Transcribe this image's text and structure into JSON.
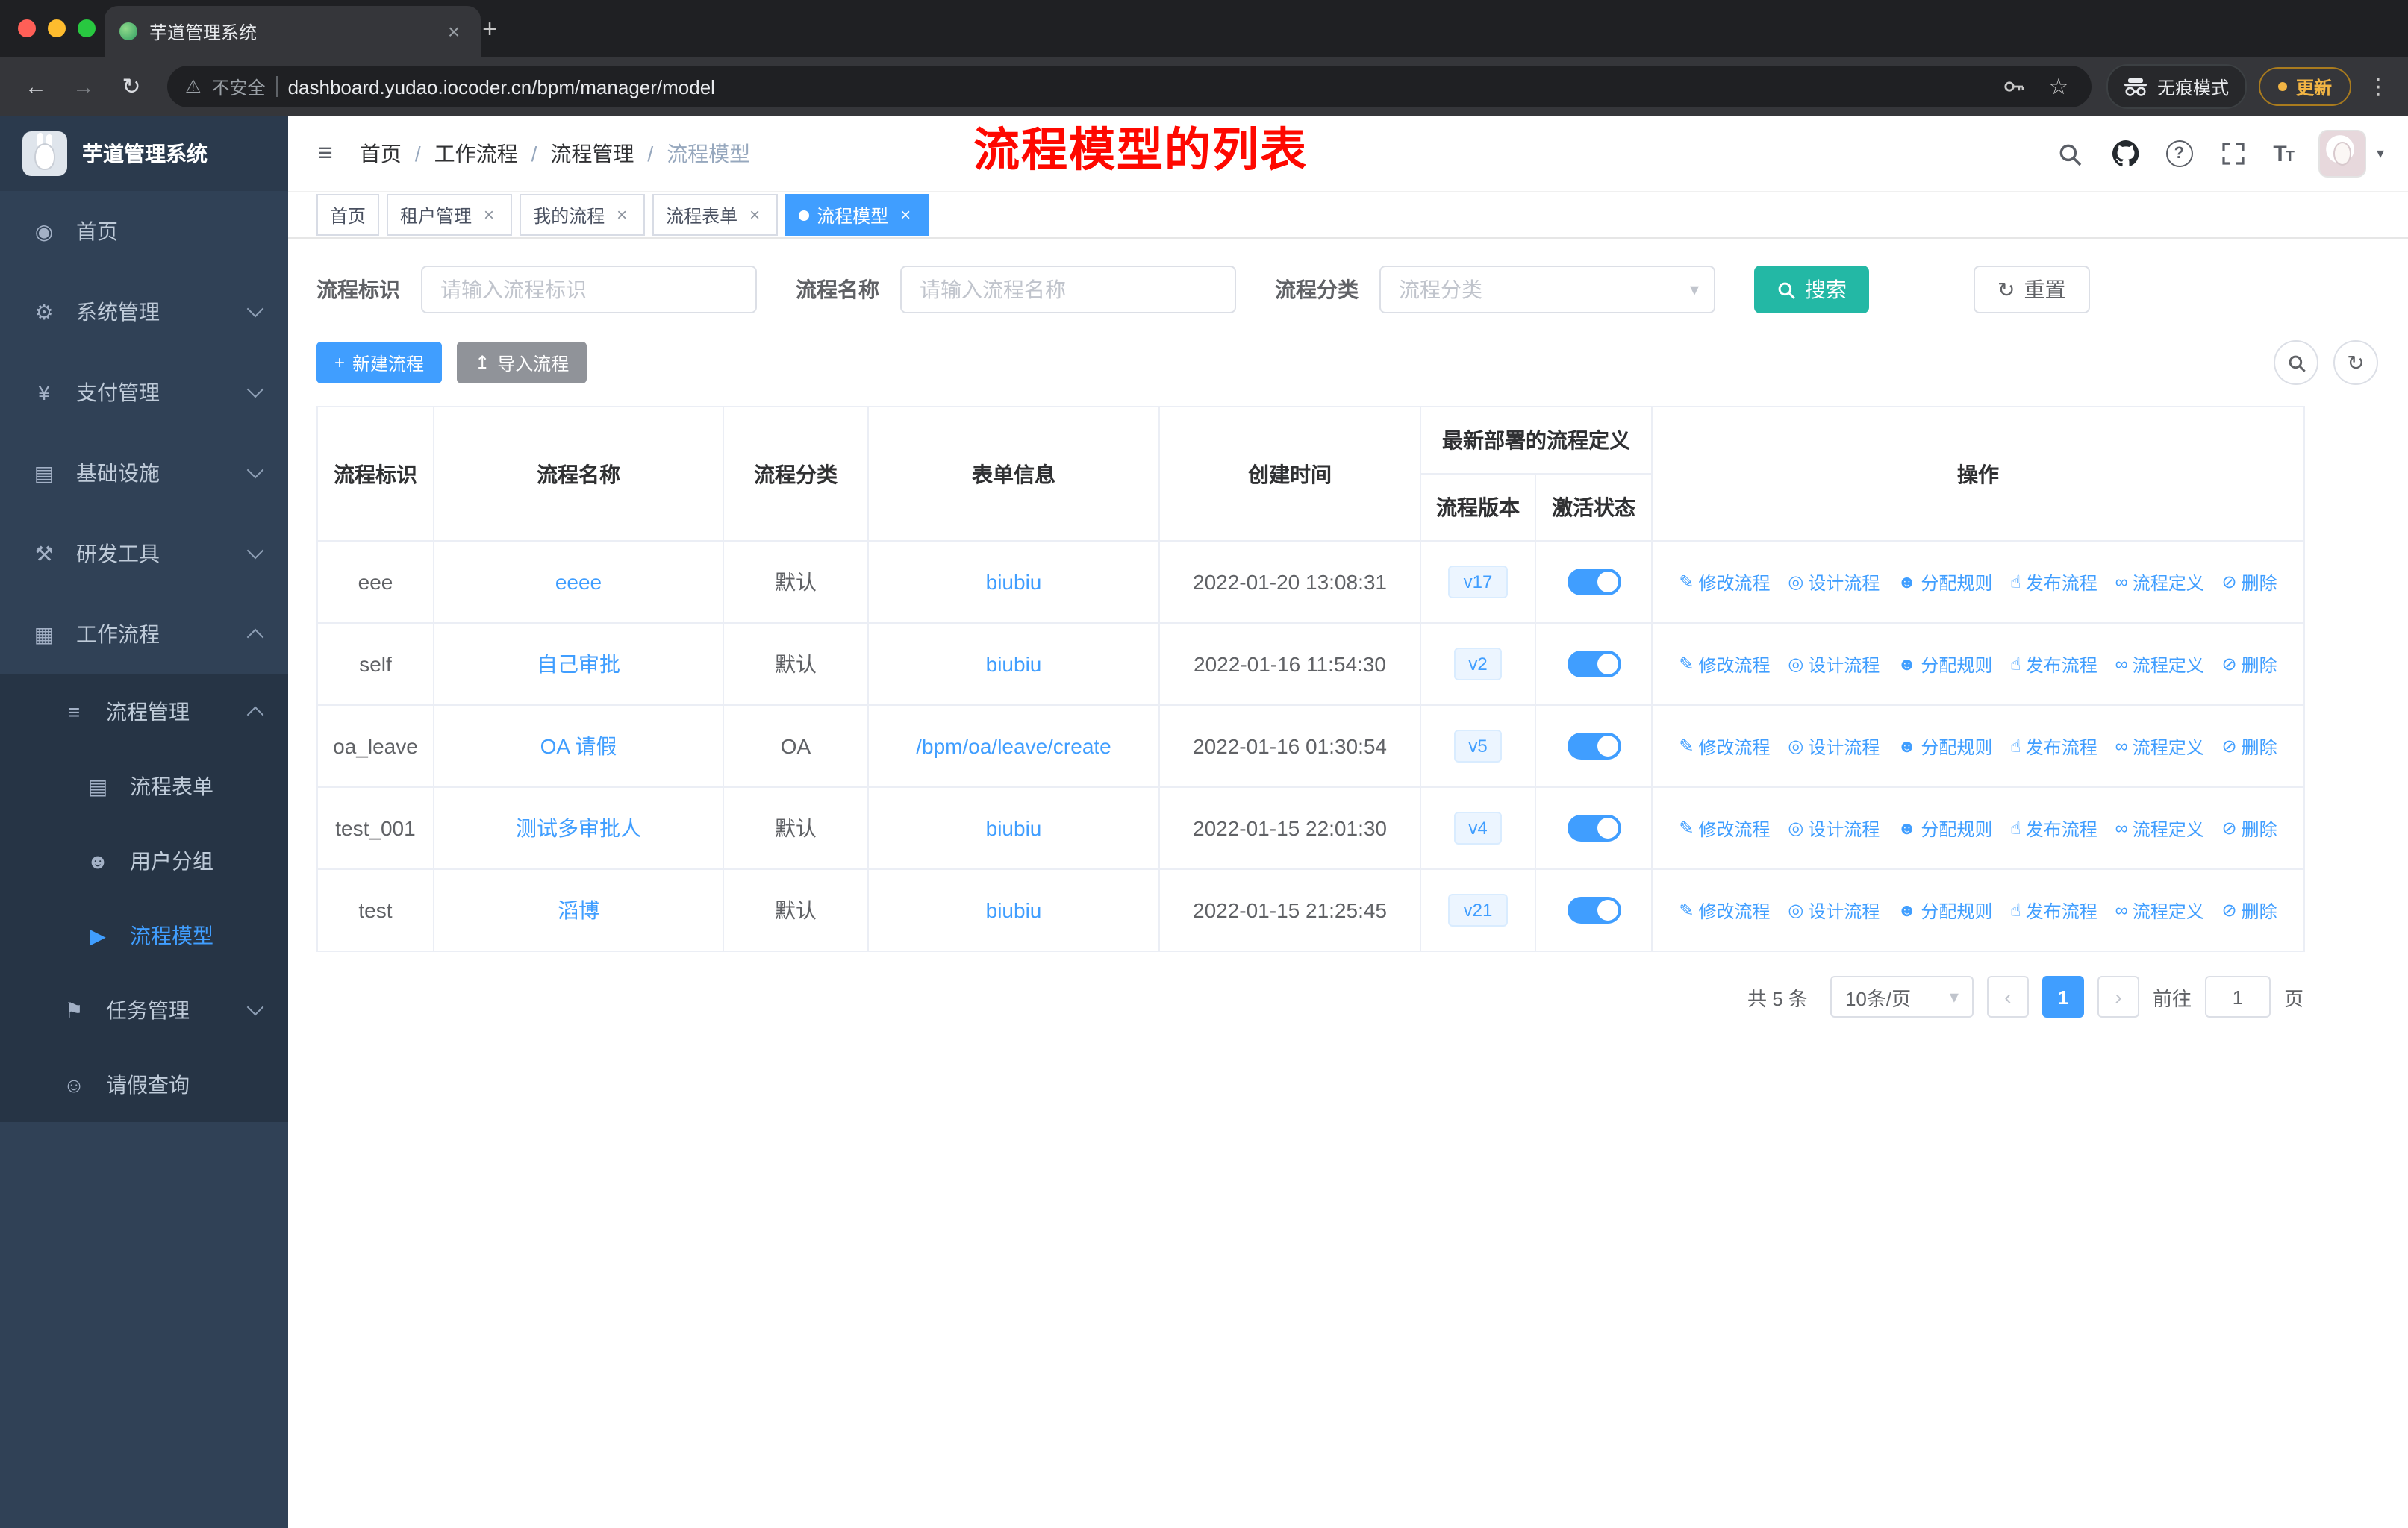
{
  "colors": {
    "primary": "#409EFF",
    "search_button_teal": "#23B8A5",
    "annotation_red": "#FE0800",
    "sidebar_bg": "#304156",
    "sidebar_active_text": "#409EFF",
    "tag_active_bg": "#409EFF",
    "version_badge_bg": "#ECF5FF",
    "toggle_on": "#409EFF"
  },
  "icons": {
    "hamburger": "≡",
    "dashboard": "◉",
    "gear": "⚙",
    "yen": "¥",
    "infra": "▤",
    "tools": "⚒",
    "workflow": "▦",
    "tree": "≡",
    "form": "▤",
    "users": "☻",
    "send": "▶",
    "task": "⚑",
    "person": "☺",
    "plus": "+",
    "upload": "↥",
    "refresh": "↻",
    "edit": "✎",
    "design": "◎",
    "assign": "☻",
    "publish": "☝",
    "definition": "∞",
    "delete": "⊘",
    "warning": "⚠",
    "star": "☆",
    "back": "←",
    "forward": "→",
    "reload": "↻",
    "kebab": "⋮",
    "close": "×",
    "newtab": "+",
    "caret_down": "▾",
    "question": "?"
  },
  "browser": {
    "tab_title": "芋道管理系统",
    "security_label": "不安全",
    "url": "dashboard.yudao.iocoder.cn/bpm/manager/model",
    "incognito_label": "无痕模式",
    "update_label": "更新"
  },
  "sidebar": {
    "logo_title": "芋道管理系统",
    "items": [
      {
        "label": "首页"
      },
      {
        "label": "系统管理"
      },
      {
        "label": "支付管理"
      },
      {
        "label": "基础设施"
      },
      {
        "label": "研发工具"
      },
      {
        "label": "工作流程",
        "expanded": true,
        "children": [
          {
            "label": "流程管理",
            "expanded": true,
            "children": [
              {
                "label": "流程表单"
              },
              {
                "label": "用户分组"
              },
              {
                "label": "流程模型",
                "active": true
              }
            ]
          },
          {
            "label": "任务管理"
          },
          {
            "label": "请假查询"
          }
        ]
      }
    ]
  },
  "header": {
    "breadcrumb": [
      "首页",
      "工作流程",
      "流程管理",
      "流程模型"
    ],
    "annotation": "流程模型的列表"
  },
  "tags": [
    {
      "label": "首页",
      "closable": false,
      "active": false
    },
    {
      "label": "租户管理",
      "closable": true,
      "active": false
    },
    {
      "label": "我的流程",
      "closable": true,
      "active": false
    },
    {
      "label": "流程表单",
      "closable": true,
      "active": false
    },
    {
      "label": "流程模型",
      "closable": true,
      "active": true
    }
  ],
  "filters": {
    "key_label": "流程标识",
    "key_placeholder": "请输入流程标识",
    "name_label": "流程名称",
    "name_placeholder": "请输入流程名称",
    "category_label": "流程分类",
    "category_placeholder": "流程分类",
    "search_label": "搜索",
    "reset_label": "重置"
  },
  "toolbar": {
    "create_label": "新建流程",
    "import_label": "导入流程"
  },
  "table": {
    "headers": {
      "key": "流程标识",
      "name": "流程名称",
      "category": "流程分类",
      "form": "表单信息",
      "created": "创建时间",
      "deployment": "最新部署的流程定义",
      "version": "流程版本",
      "status": "激活状态",
      "actions": "操作"
    },
    "action_labels": [
      "修改流程",
      "设计流程",
      "分配规则",
      "发布流程",
      "流程定义",
      "删除"
    ],
    "rows": [
      {
        "key": "eee",
        "name": "eeee",
        "category": "默认",
        "form": "biubiu",
        "created": "2022-01-20 13:08:31",
        "version": "v17",
        "active": true
      },
      {
        "key": "self",
        "name": "自己审批",
        "category": "默认",
        "form": "biubiu",
        "created": "2022-01-16 11:54:30",
        "version": "v2",
        "active": true
      },
      {
        "key": "oa_leave",
        "name": "OA 请假",
        "category": "OA",
        "form": "/bpm/oa/leave/create",
        "created": "2022-01-16 01:30:54",
        "version": "v5",
        "active": true
      },
      {
        "key": "test_001",
        "name": "测试多审批人",
        "category": "默认",
        "form": "biubiu",
        "created": "2022-01-15 22:01:30",
        "version": "v4",
        "active": true
      },
      {
        "key": "test",
        "name": "滔博",
        "category": "默认",
        "form": "biubiu",
        "created": "2022-01-15 21:25:45",
        "version": "v21",
        "active": true
      }
    ]
  },
  "pagination": {
    "total": "共 5 条",
    "page_size": "10条/页",
    "current_page": "1",
    "goto_label": "前往",
    "goto_value": "1",
    "unit": "页"
  }
}
